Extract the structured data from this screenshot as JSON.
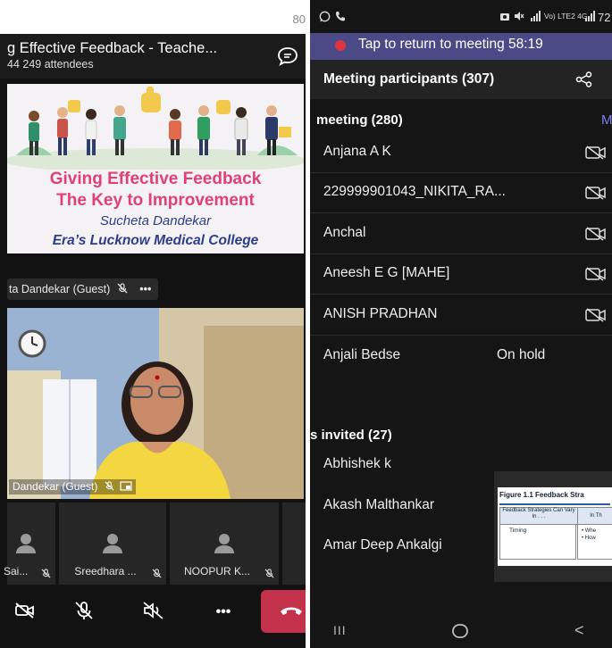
{
  "left": {
    "status_number": "80",
    "meeting_title": "g Effective Feedback - Teache...",
    "meeting_subtitle": "44  249 attendees",
    "slide": {
      "line1": "Giving Effective Feedback",
      "line2": "The Key to Improvement",
      "line3": "Sucheta Dandekar",
      "line4": "Era’s Lucknow Medical College"
    },
    "speaker_chip": "ta Dandekar (Guest)",
    "more_glyph": "•••",
    "video_label": "Dandekar (Guest)",
    "tiles": [
      {
        "name": "Sai..."
      },
      {
        "name": "Sreedhara ..."
      },
      {
        "name": "NOOPUR K..."
      }
    ],
    "controls": {
      "more_label": "•••"
    }
  },
  "right": {
    "status_time": "72",
    "status_icons": "Vo) LTE2 4G",
    "banner_text": "Tap to return to meeting 58:19",
    "header_title": "Meeting participants (307)",
    "section_in_meeting": "meeting (280)",
    "section_in_meeting_action": "M",
    "participants": [
      {
        "name": "Anjana A K",
        "status": ""
      },
      {
        "name": "229999901043_NIKITA_RA...",
        "status": ""
      },
      {
        "name": "Anchal",
        "status": ""
      },
      {
        "name": "Aneesh E G [MAHE]",
        "status": ""
      },
      {
        "name": "ANISH PRADHAN",
        "status": ""
      },
      {
        "name": "Anjali Bedse",
        "status": "On hold"
      }
    ],
    "section_invited": "s invited (27)",
    "invited": [
      {
        "name": "Abhishek k"
      },
      {
        "name": "Akash Malthankar"
      },
      {
        "name": "Amar Deep Ankalgi"
      }
    ],
    "thumb": {
      "caption": "Figure 1.1  Feedback Stra",
      "col1_header": "Feedback Strategies Can Vary In . . .",
      "col2_header": "In Th",
      "row_label": "Timing",
      "row_bullet1": "• Whe",
      "row_bullet2": "• How"
    },
    "nav": {
      "recents": "III",
      "back": "<"
    }
  }
}
